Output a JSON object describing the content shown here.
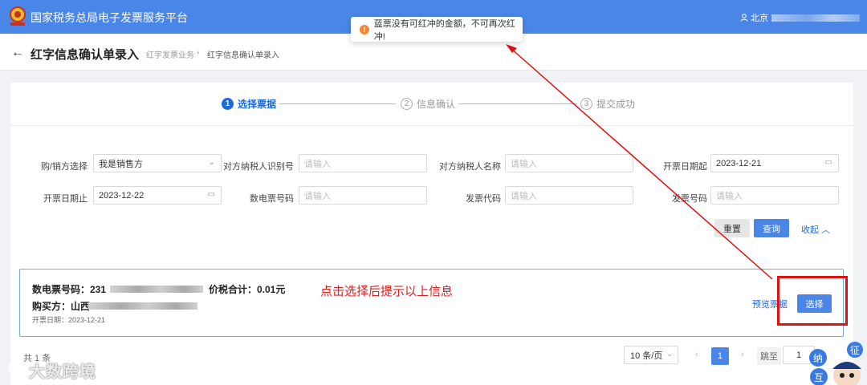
{
  "topbar": {
    "app_title": "国家税务总局电子发票服务平台",
    "user_name": "北京"
  },
  "toast": {
    "message": "蓝票没有可红冲的金额，不可再次红冲!"
  },
  "header": {
    "title": "红字信息确认单录入",
    "breadcrumb": [
      "红字发票业务",
      "红字信息确认单录入"
    ]
  },
  "steps": [
    {
      "num": "1",
      "label": "选择票据"
    },
    {
      "num": "2",
      "label": "信息确认"
    },
    {
      "num": "3",
      "label": "提交成功"
    }
  ],
  "filters": {
    "role_label": "购/销方选择",
    "role_value": "我是销售方",
    "tin_label": "对方纳税人识别号",
    "tin_placeholder": "请输入",
    "name_label": "对方纳税人名称",
    "name_placeholder": "请输入",
    "start_label": "开票日期起",
    "start_value": "2023-12-21",
    "end_label": "开票日期止",
    "end_value": "2023-12-22",
    "einv_label": "数电票号码",
    "einv_placeholder": "请输入",
    "code_label": "发票代码",
    "code_placeholder": "请输入",
    "no_label": "发票号码",
    "no_placeholder": "请输入",
    "reset_label": "重置",
    "query_label": "查询",
    "collapse_label": "收起"
  },
  "result": {
    "einv_label": "数电票号码：231",
    "total_label": "价税合计：0.01元",
    "buyer_label": "购买方：山西",
    "date_label": "开票日期：2023-12-21",
    "preview_label": "预览票据",
    "select_label": "选择"
  },
  "annotation": {
    "text": "点击选择后提示以上信息"
  },
  "pagination": {
    "total": "共 1 条",
    "page_size": "10 条/页",
    "current": "1",
    "jump_label": "跳至",
    "jump_value": "1"
  },
  "watermark": {
    "text": "大数跨境"
  },
  "mascot": {
    "text_1": "征",
    "text_2": "纳",
    "text_3": "互"
  },
  "colors": {
    "primary": "#4a86e8",
    "annotation": "#e01010",
    "warning": "#f0883a"
  }
}
